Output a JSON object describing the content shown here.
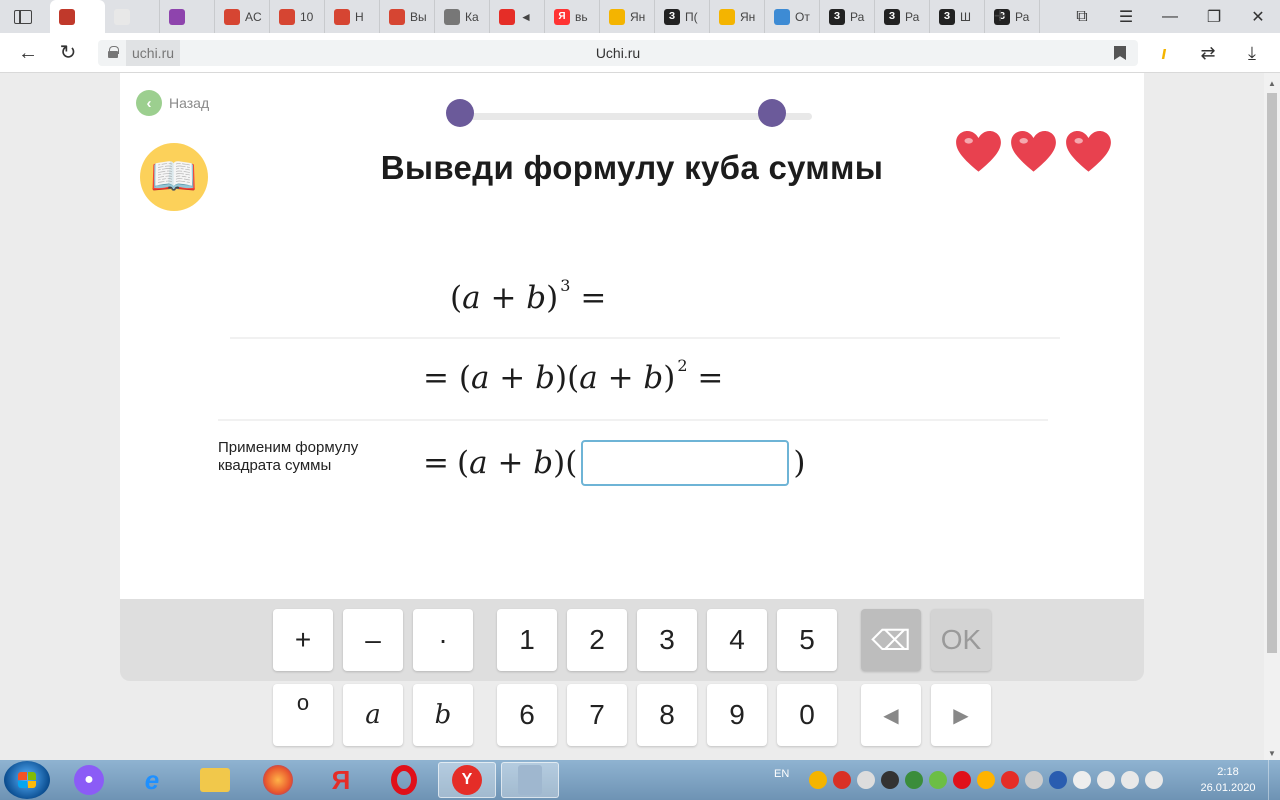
{
  "browser": {
    "tabs": [
      {
        "title": "",
        "color": "#c0392b"
      },
      {
        "title": "",
        "color": "#e8e8e8"
      },
      {
        "title": "",
        "color": "#8e44ad"
      },
      {
        "title": "AC",
        "color": "#d64532"
      },
      {
        "title": "10",
        "color": "#d64532"
      },
      {
        "title": "Н",
        "color": "#d64532"
      },
      {
        "title": "Вы",
        "color": "#d64532"
      },
      {
        "title": "Ка",
        "color": "#777777"
      },
      {
        "title": "◄",
        "color": "#e52d27"
      },
      {
        "title": "вь",
        "color": "#ff3333"
      },
      {
        "title": "Ян",
        "color": "#f4b400"
      },
      {
        "title": "П(",
        "color": "#222222"
      },
      {
        "title": "Ян",
        "color": "#f4b400"
      },
      {
        "title": "От",
        "color": "#3d8bd4"
      },
      {
        "title": "Ра",
        "color": "#222222"
      },
      {
        "title": "Ра",
        "color": "#222222"
      },
      {
        "title": "Ш",
        "color": "#222222"
      },
      {
        "title": "Ра",
        "color": "#222222"
      }
    ],
    "tab_letters": [
      "",
      "",
      "",
      "",
      "",
      "",
      "",
      "",
      "",
      "Я",
      "",
      "З",
      "",
      "",
      "З",
      "З",
      "З",
      "З"
    ],
    "active_tab_index": 0,
    "new_tab": "+",
    "url_domain": "uchi.ru",
    "page_title": "Uchi.ru"
  },
  "lesson": {
    "back_label": "Назад",
    "progress_dots": 2,
    "title": "Выведи формулу куба суммы",
    "lives": 3,
    "heart_color": "#e8414f",
    "accent_color": "#6b5a9a",
    "row1": {
      "open": "(",
      "a": "a",
      "plus": "+",
      "b": "b",
      "close": ")",
      "power": "3",
      "eq": "="
    },
    "row2": {
      "eq_lead": "=",
      "left": "(a + b)(a + b)",
      "power": "2",
      "eq": "="
    },
    "row3": {
      "hint_line1": "Применим формулу",
      "hint_line2": "квадрата суммы",
      "eq_lead": "=",
      "left": "(a + b)(",
      "right": ")",
      "answer": ""
    }
  },
  "keyboard": {
    "row1": [
      "+",
      "–",
      "·",
      "1",
      "2",
      "3",
      "4",
      "5"
    ],
    "row2": [
      "",
      "a",
      "b",
      "6",
      "7",
      "8",
      "9",
      "0"
    ],
    "degree_symbol": "o",
    "backspace": "⌫",
    "ok": "OK",
    "left": "◀",
    "right": "▶"
  },
  "taskbar": {
    "lang": "EN",
    "time": "2:18",
    "date": "26.01.2020"
  }
}
